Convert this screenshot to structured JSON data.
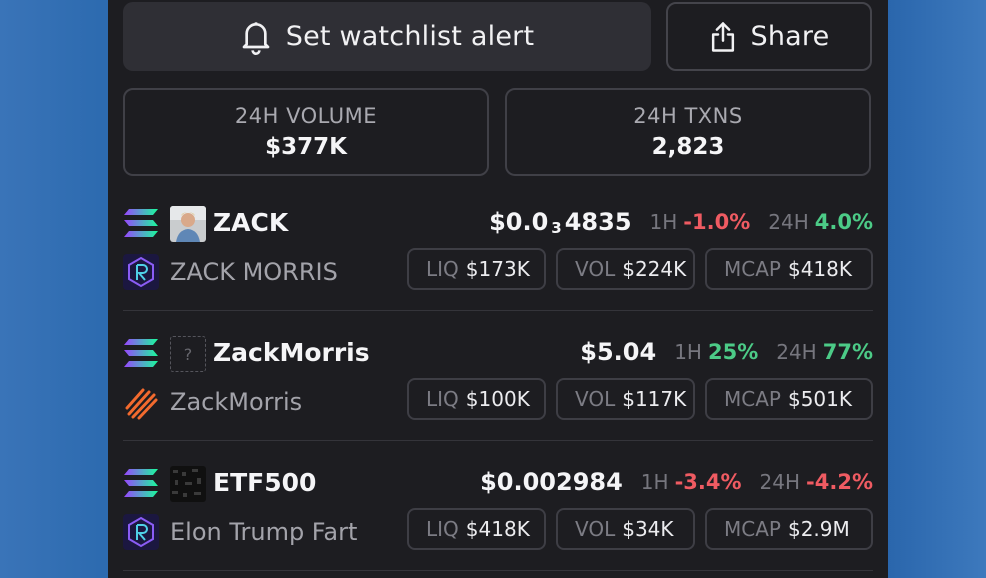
{
  "actions": {
    "alert_label": "Set watchlist alert",
    "share_label": "Share"
  },
  "stats": {
    "volume_label": "24H VOLUME",
    "volume_value": "$377K",
    "txns_label": "24H TXNS",
    "txns_value": "2,823"
  },
  "tokens": [
    {
      "symbol": "ZACK",
      "name": "ZACK MORRIS",
      "price_prefix": "$0.0",
      "price_zeros": "3",
      "price_digits": "4835",
      "h1_label": "1H",
      "h1_change": "-1.0%",
      "h24_label": "24H",
      "h24_change": "4.0%",
      "liq_label": "LIQ",
      "liq_value": "$173K",
      "vol_label": "VOL",
      "vol_value": "$224K",
      "mcap_label": "MCAP",
      "mcap_value": "$418K",
      "chain_icon": "solana-icon",
      "dex_icon": "raydium-icon",
      "colors": {
        "h1": "#ef5b62",
        "h24": "#4ccb87"
      }
    },
    {
      "symbol": "ZackMorris",
      "name": "ZackMorris",
      "price": "$5.04",
      "h1_label": "1H",
      "h1_change": "25%",
      "h24_label": "24H",
      "h24_change": "77%",
      "liq_label": "LIQ",
      "liq_value": "$100K",
      "vol_label": "VOL",
      "vol_value": "$117K",
      "mcap_label": "MCAP",
      "mcap_value": "$501K",
      "placeholder_glyph": "?",
      "chain_icon": "solana-icon",
      "dex_icon": "pump-stripes-icon",
      "colors": {
        "h1": "#4ccb87",
        "h24": "#4ccb87"
      }
    },
    {
      "symbol": "ETF500",
      "name": "Elon Trump Fart",
      "price": "$0.002984",
      "h1_label": "1H",
      "h1_change": "-3.4%",
      "h24_label": "24H",
      "h24_change": "-4.2%",
      "liq_label": "LIQ",
      "liq_value": "$418K",
      "vol_label": "VOL",
      "vol_value": "$34K",
      "mcap_label": "MCAP",
      "mcap_value": "$2.9M",
      "chain_icon": "solana-icon",
      "dex_icon": "raydium-icon",
      "colors": {
        "h1": "#ef5b62",
        "h24": "#ef5b62"
      }
    }
  ]
}
